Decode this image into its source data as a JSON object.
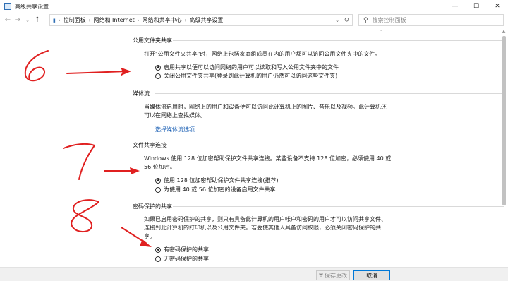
{
  "window": {
    "title": "高级共享设置",
    "controls": [
      "—",
      "☐",
      "✕"
    ]
  },
  "nav": {
    "back_icon": "back-arrow-icon",
    "forward_icon": "forward-arrow-icon",
    "recent_icon": "chevron-down-icon",
    "up_icon": "up-arrow-icon",
    "breadcrumbs": [
      "控制面板",
      "网络和 Internet",
      "网络和共享中心",
      "高级共享设置"
    ],
    "search_placeholder": "搜索控制面板"
  },
  "sections": {
    "public_folder": {
      "heading": "公用文件夹共享",
      "description": "打开\"公用文件夹共享\"时，网络上包括家庭组成员在内的用户都可以访问公用文件夹中的文件。",
      "options": [
        {
          "label": "启用共享以便可以访问网络的用户可以读取和写入公用文件夹中的文件",
          "checked": true
        },
        {
          "label": "关闭公用文件夹共享(登录到此计算机的用户仍然可以访问这些文件夹)",
          "checked": false
        }
      ]
    },
    "media_streaming": {
      "heading": "媒体流",
      "description_line1": "当媒体流启用时，网络上的用户和设备便可以访问此计算机上的图片、音乐以及视频。此计算机还",
      "description_line2": "可以在网络上查找媒体。",
      "link": "选择媒体流选项..."
    },
    "file_sharing_connection": {
      "heading": "文件共享连接",
      "description_line1": "Windows 使用 128 位加密帮助保护文件共享连接。某些设备不支持 128 位加密，必须使用 40 或",
      "description_line2": "56 位加密。",
      "options": [
        {
          "label": "使用 128 位加密帮助保护文件共享连接(推荐)",
          "checked": true
        },
        {
          "label": "为使用 40 或 56 位加密的设备启用文件共享",
          "checked": false
        }
      ]
    },
    "password_protected": {
      "heading": "密码保护的共享",
      "description_line1": "如果已启用密码保护的共享，则只有具备此计算机的用户帐户和密码的用户才可以访问共享文件、",
      "description_line2": "连接到此计算机的打印机以及公用文件夹。若要使其他人具备访问权限，必须关闭密码保护的共",
      "description_line3": "享。",
      "options": [
        {
          "label": "有密码保护的共享",
          "checked": true
        },
        {
          "label": "无密码保护的共享",
          "checked": false
        }
      ]
    }
  },
  "footer": {
    "save_label": "保存更改",
    "cancel_label": "取消"
  },
  "annotations": {
    "marks": [
      "6",
      "7",
      "8"
    ],
    "color": "#e02020"
  },
  "colors": {
    "link": "#1a5fb4",
    "accent": "#0078d7"
  }
}
